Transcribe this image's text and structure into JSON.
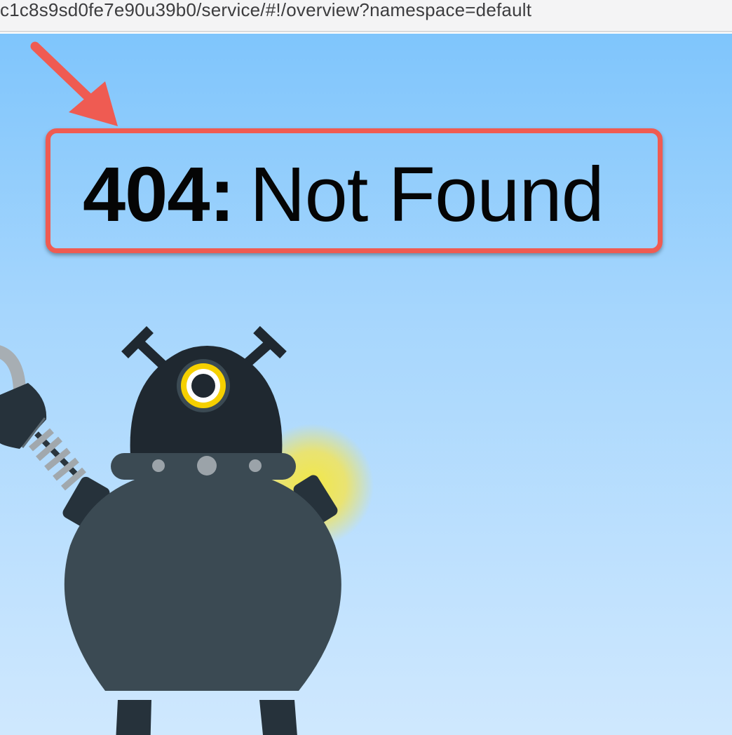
{
  "browser": {
    "url": "c1c8s9sd0fe7e90u39b0/service/#!/overview?namespace=default"
  },
  "error": {
    "code": "404:",
    "message": "Not Found"
  },
  "colors": {
    "annotation": "#ef5b52",
    "robot_dark": "#1f2830",
    "robot_body": "#3b4a53",
    "robot_eye_ring": "#f5d000",
    "glow": "#f2e45a",
    "sky_top": "#7fc5fc",
    "sky_bottom": "#cfe8fe"
  },
  "icons": {
    "arrow": "annotation-arrow-icon",
    "robot": "robot-illustration"
  }
}
